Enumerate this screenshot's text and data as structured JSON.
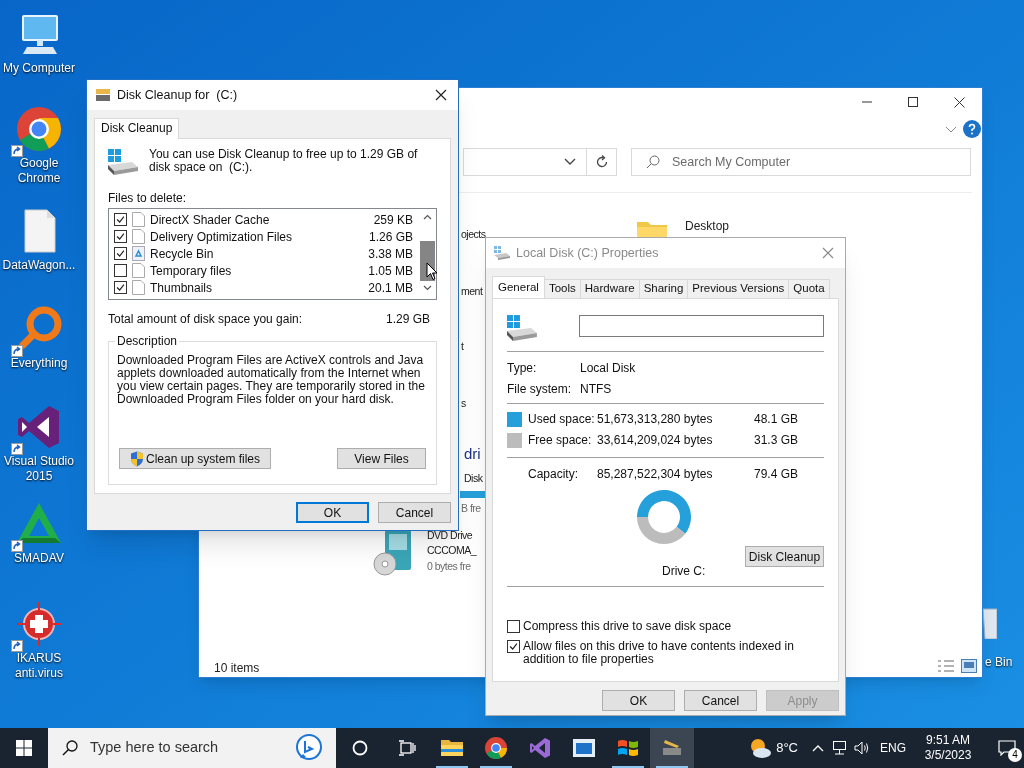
{
  "desktop_icons": [
    {
      "label": "My Computer",
      "kind": "computer",
      "shortcut": false
    },
    {
      "label": "Google Chrome",
      "kind": "chrome",
      "shortcut": true
    },
    {
      "label": "DataWagon...",
      "kind": "file",
      "shortcut": false
    },
    {
      "label": "Everything",
      "kind": "everything",
      "shortcut": true
    },
    {
      "label": "Visual Studio 2015",
      "kind": "vs",
      "shortcut": true
    },
    {
      "label": "SMADAV",
      "kind": "smadav",
      "shortcut": true
    },
    {
      "label": "IKARUS anti.virus",
      "kind": "ikarus",
      "shortcut": true
    }
  ],
  "recycle_bin_label": "e Bin",
  "explorer": {
    "search_placeholder": "Search My Computer",
    "items": [
      {
        "kind": "text",
        "text": "ojects"
      },
      {
        "kind": "folder",
        "text": "Desktop"
      },
      {
        "kind": "text",
        "text": "ment"
      },
      {
        "kind": "text",
        "text": "t"
      },
      {
        "kind": "text",
        "text": "s"
      },
      {
        "kind": "heading",
        "text": "dri"
      },
      {
        "kind": "text",
        "text": "Disk"
      },
      {
        "kind": "muted",
        "text": "B fre"
      },
      {
        "kind": "text",
        "text": "DVD Drive"
      },
      {
        "kind": "text",
        "text": "CCCOMA_"
      },
      {
        "kind": "muted",
        "text": "0 bytes fre"
      }
    ],
    "status": "10 items"
  },
  "disk_cleanup": {
    "title": "Disk Cleanup for  (C:)",
    "tab": "Disk Cleanup",
    "intro": "You can use Disk Cleanup to free up to 1.29 GB of disk space on  (C:).",
    "files_label": "Files to delete:",
    "files": [
      {
        "name": "DirectX Shader Cache",
        "size": "259 KB",
        "checked": true,
        "kind": "file"
      },
      {
        "name": "Delivery Optimization Files",
        "size": "1.26 GB",
        "checked": true,
        "kind": "file"
      },
      {
        "name": "Recycle Bin",
        "size": "3.38 MB",
        "checked": true,
        "kind": "recycle"
      },
      {
        "name": "Temporary files",
        "size": "1.05 MB",
        "checked": false,
        "kind": "file"
      },
      {
        "name": "Thumbnails",
        "size": "20.1 MB",
        "checked": true,
        "kind": "file"
      }
    ],
    "total_label": "Total amount of disk space you gain:",
    "total_value": "1.29 GB",
    "description_label": "Description",
    "description": "Downloaded Program Files are ActiveX controls and Java applets downloaded automatically from the Internet when you view certain pages. They are temporarily stored in the Downloaded Program Files folder on your hard disk.",
    "buttons": [
      "Clean up system files",
      "View Files"
    ],
    "footer_buttons": [
      {
        "label": "OK",
        "focused": true
      },
      {
        "label": "Cancel",
        "focused": false
      }
    ]
  },
  "properties": {
    "title": "Local Disk (C:) Properties",
    "tabs": [
      {
        "label": "General",
        "selected": true
      },
      {
        "label": "Tools",
        "selected": false
      },
      {
        "label": "Hardware",
        "selected": false
      },
      {
        "label": "Sharing",
        "selected": false
      },
      {
        "label": "Previous Versions",
        "selected": false
      },
      {
        "label": "Quota",
        "selected": false
      }
    ],
    "info": [
      {
        "label": "Type:",
        "value": "Local Disk"
      },
      {
        "label": "File system:",
        "value": "NTFS"
      }
    ],
    "space": [
      {
        "label": "Used space:",
        "bytes": "51,673,313,280 bytes",
        "size": "48.1 GB",
        "color": "#26a0da"
      },
      {
        "label": "Free space:",
        "bytes": "33,614,209,024 bytes",
        "size": "31.3 GB",
        "color": "#bcbcbc"
      }
    ],
    "capacity": {
      "label": "Capacity:",
      "bytes": "85,287,522,304 bytes",
      "size": "79.4 GB"
    },
    "drive_label": "Drive C:",
    "cleanup_button": "Disk Cleanup",
    "options": [
      {
        "label": "Compress this drive to save disk space",
        "checked": false
      },
      {
        "label": "Allow files on this drive to have contents indexed in addition to file properties",
        "checked": true
      }
    ],
    "buttons": [
      {
        "label": "OK",
        "disabled": false
      },
      {
        "label": "Cancel",
        "disabled": false
      },
      {
        "label": "Apply",
        "disabled": true
      }
    ]
  },
  "taskbar": {
    "search_placeholder": "Type here to search",
    "apps": [
      {
        "kind": "explorer",
        "running": true,
        "selected": false
      },
      {
        "kind": "chrome",
        "running": true,
        "selected": false
      },
      {
        "kind": "vs",
        "running": false,
        "selected": false
      },
      {
        "kind": "window",
        "running": false,
        "selected": false
      },
      {
        "kind": "windows",
        "running": true,
        "selected": false
      },
      {
        "kind": "cleanup",
        "running": true,
        "selected": true
      }
    ],
    "temperature": "8°C",
    "language": "ENG",
    "time": "9:51 AM",
    "date": "3/5/2023",
    "notifications": "4"
  }
}
